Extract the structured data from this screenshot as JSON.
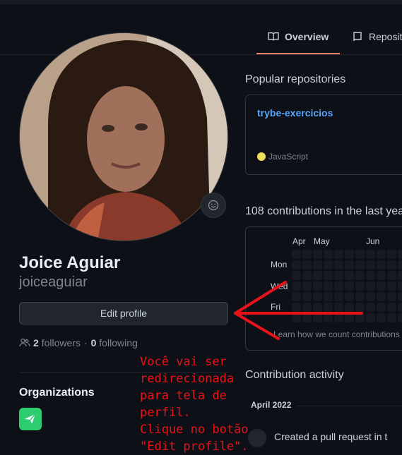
{
  "tabs": [
    {
      "label": "Overview",
      "icon": "book-icon",
      "active": true
    },
    {
      "label": "Reposit",
      "icon": "repo-icon",
      "active": false
    }
  ],
  "profile": {
    "full_name": "Joice Aguiar",
    "username": "joiceaguiar",
    "edit_button": "Edit profile",
    "followers_count": "2",
    "followers_label": "followers",
    "separator": "·",
    "following_count": "0",
    "following_label": "following"
  },
  "organizations": {
    "title": "Organizations",
    "org_color": "#2ecc71"
  },
  "popular": {
    "title": "Popular repositories",
    "repo": {
      "name": "trybe-exercicios",
      "language": "JavaScript",
      "language_color": "#f1e05a"
    }
  },
  "contributions": {
    "title": "108 contributions in the last yea",
    "months": [
      "Apr",
      "May",
      "Jun"
    ],
    "days": [
      "Mon",
      "Wed",
      "Fri"
    ],
    "learn_more": "Learn how we count contributions"
  },
  "activity": {
    "title": "Contribution activity",
    "month": "April 2022",
    "item": "Created a pull request in t"
  },
  "annotation": {
    "text": "Você vai ser\nredirecionada\npara tela de perfil.\nClique no botão\n\"Edit profile\".",
    "color": "#e8121a"
  },
  "colors": {
    "background": "#0d1117",
    "accent_underline": "#f78166",
    "link": "#58a6ff"
  }
}
